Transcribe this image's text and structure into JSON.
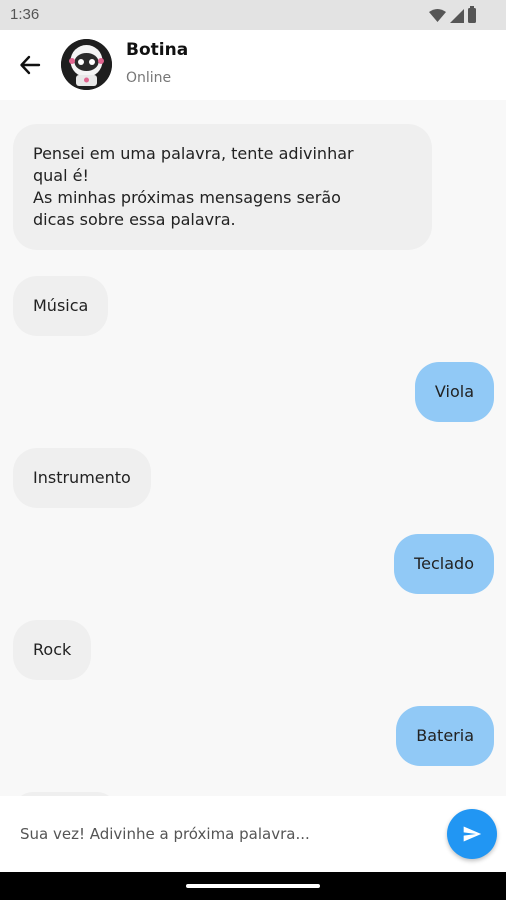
{
  "status_bar": {
    "time": "1:36",
    "icons": [
      "wifi-icon",
      "signal-icon",
      "battery-icon"
    ]
  },
  "header": {
    "contact_name": "Botina",
    "contact_status": "Online",
    "back_icon": "arrow-left-icon",
    "avatar_icon": "robot-avatar"
  },
  "messages": [
    {
      "sender": "bot",
      "text": "Pensei em uma palavra, tente adivinhar\nqual é!\nAs minhas próximas mensagens serão\ndicas sobre essa palavra."
    },
    {
      "sender": "bot",
      "text": "Música"
    },
    {
      "sender": "user",
      "text": "Viola"
    },
    {
      "sender": "bot",
      "text": "Instrumento"
    },
    {
      "sender": "user",
      "text": "Teclado"
    },
    {
      "sender": "bot",
      "text": "Rock"
    },
    {
      "sender": "user",
      "text": "Bateria"
    }
  ],
  "input": {
    "placeholder": "Sua vez! Adivinhe a próxima palavra...",
    "value": "",
    "send_icon": "send-icon"
  },
  "colors": {
    "bot_bubble": "#efefef",
    "user_bubble": "#91c9f6",
    "send_button": "#2196f3",
    "chat_background": "#f8f8f8"
  }
}
